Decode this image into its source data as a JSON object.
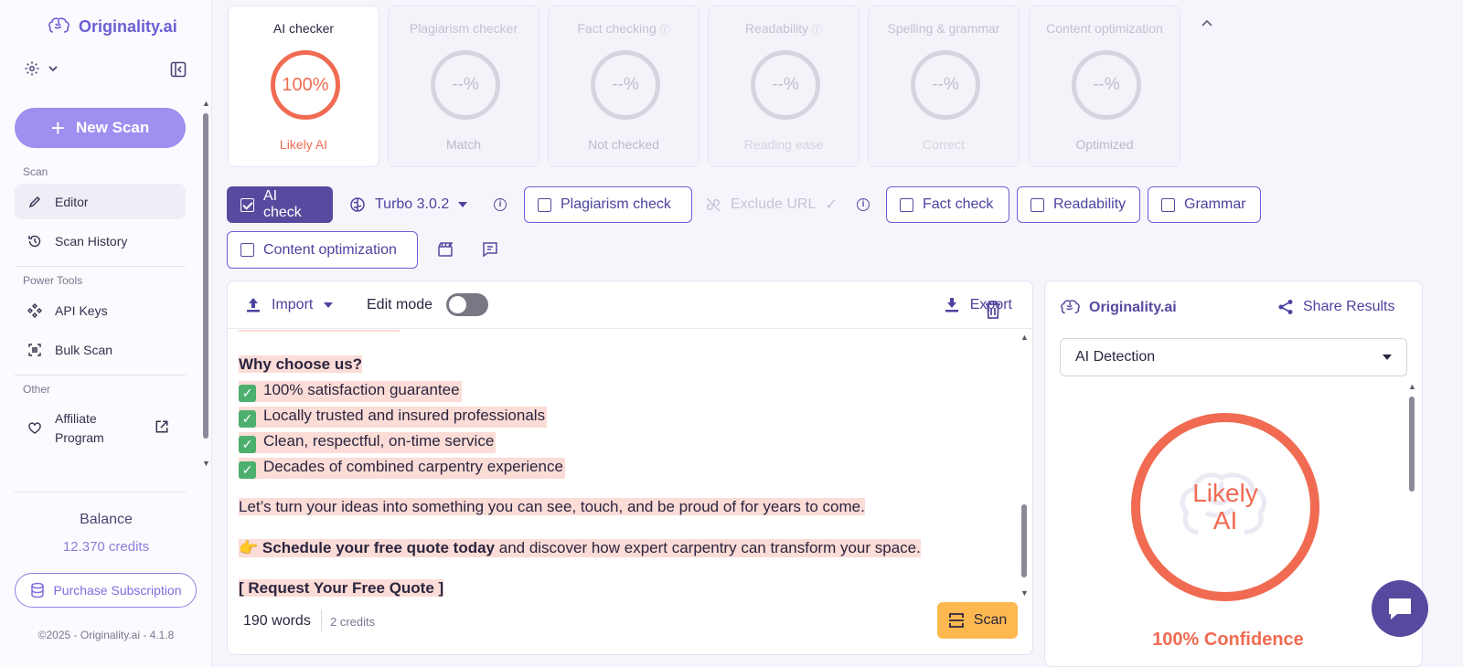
{
  "sidebar": {
    "brand": "Originality.ai",
    "new_scan": "New Scan",
    "sections": {
      "scan": "Scan",
      "power_tools": "Power Tools",
      "other": "Other"
    },
    "items": {
      "editor": "Editor",
      "history": "Scan History",
      "api_keys": "API Keys",
      "bulk_scan": "Bulk Scan",
      "affiliate_1": "Affiliate",
      "affiliate_2": "Program"
    },
    "balance_label": "Balance",
    "credits": "12.370 credits",
    "purchase": "Purchase Subscription",
    "copyright": "©2025 - Originality.ai - 4.1.8"
  },
  "cards": [
    {
      "title": "AI checker",
      "value": "100%",
      "sub": "Likely AI"
    },
    {
      "title": "Plagiarism checker",
      "value": "--%",
      "sub": "Match"
    },
    {
      "title": "Fact checking",
      "value": "--%",
      "sub": "Not checked"
    },
    {
      "title": "Readability",
      "value": "--%",
      "sub": "Reading ease"
    },
    {
      "title": "Spelling & grammar",
      "value": "--%",
      "sub": "Correct"
    },
    {
      "title": "Content optimization",
      "value": "--%",
      "sub": "Optimized"
    }
  ],
  "toolbar": {
    "ai_check": "AI check",
    "model": "Turbo 3.0.2",
    "plagiarism": "Plagiarism check",
    "exclude_url": "Exclude URL",
    "fact": "Fact check",
    "readability": "Readability",
    "grammar": "Grammar",
    "content_opt": "Content optimization"
  },
  "editor": {
    "import": "Import",
    "edit_mode": "Edit mode",
    "export": "Export",
    "heading": "Why choose us?",
    "bullets": [
      "100% satisfaction guarantee",
      "Locally trusted and insured professionals",
      "Clean, respectful, on-time service",
      "Decades of combined carpentry experience"
    ],
    "paragraph": "Let’s turn your ideas into something you can see, touch, and be proud of for years to come.",
    "cta_emoji": "👉",
    "cta_bold": "Schedule your free quote today",
    "cta_rest": " and discover how expert carpentry can transform your space.",
    "link": "[ Request Your Free Quote ]",
    "words": "190 words",
    "credits": "2 credits",
    "scan": "Scan"
  },
  "results": {
    "brand": "Originality.ai",
    "share": "Share Results",
    "select": "AI Detection",
    "verdict_1": "Likely",
    "verdict_2": "AI",
    "confidence": "100% Confidence"
  },
  "colors": {
    "accent": "#574a9e",
    "brand_light": "#a08ef0",
    "ai_red": "#f06b52",
    "highlight": "#fbdcd6",
    "scan_button": "#fdb84f"
  }
}
